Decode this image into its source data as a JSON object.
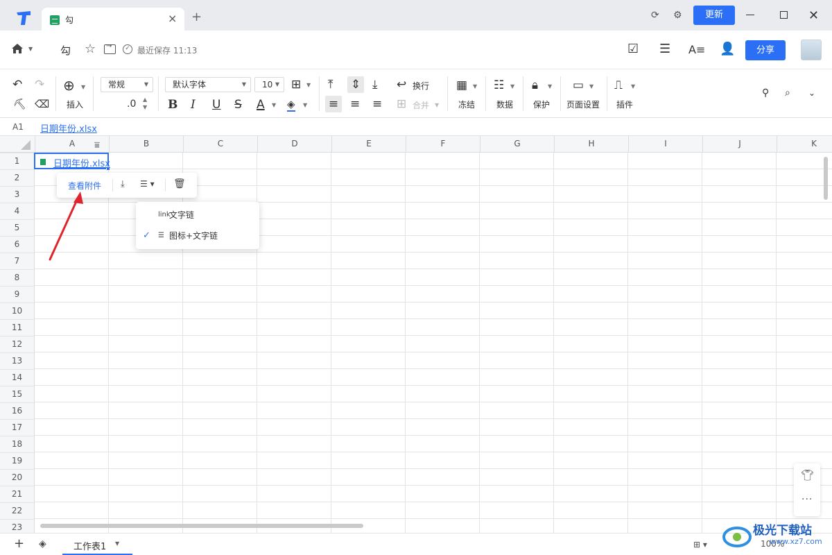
{
  "titlebar": {
    "tab_title": "勾",
    "update_label": "更新"
  },
  "docbar": {
    "doc_title": "勾",
    "save_status": "最近保存 11:13",
    "share_label": "分享"
  },
  "toolbar": {
    "insert_label": "插入",
    "number_format": "常规",
    "decimal_label": ".0",
    "font_family": "默认字体",
    "font_size": "10",
    "wrap_label": "换行",
    "merge_label": "合并",
    "freeze_label": "冻结",
    "data_label": "数据",
    "protect_label": "保护",
    "page_setup_label": "页面设置",
    "plugins_label": "插件"
  },
  "formula_bar": {
    "cell_ref": "A1",
    "value": "日期年份.xlsx"
  },
  "grid": {
    "columns": [
      "A",
      "B",
      "C",
      "D",
      "E",
      "F",
      "G",
      "H",
      "I",
      "J",
      "K"
    ],
    "rows": [
      "1",
      "2",
      "3",
      "4",
      "5",
      "6",
      "7",
      "8",
      "9",
      "10",
      "11",
      "12",
      "13",
      "14",
      "15",
      "16",
      "17",
      "18",
      "19",
      "20",
      "21",
      "22",
      "23"
    ],
    "a1_value": "日期年份.xlsx"
  },
  "attachment_popup": {
    "view_label": "查看附件"
  },
  "mode_menu": {
    "items": [
      {
        "icon": "link",
        "label": "文字链",
        "checked": false
      },
      {
        "icon": "icon-text",
        "label": "图标+文字链",
        "checked": true
      }
    ]
  },
  "sheetbar": {
    "sheet_name": "工作表1",
    "zoom": "100%"
  },
  "watermark": {
    "title": "极光下载站",
    "url": "www.xz7.com"
  },
  "colors": {
    "accent": "#2b6ff6",
    "excel_green": "#20a162",
    "arrow_red": "#e0242b"
  }
}
